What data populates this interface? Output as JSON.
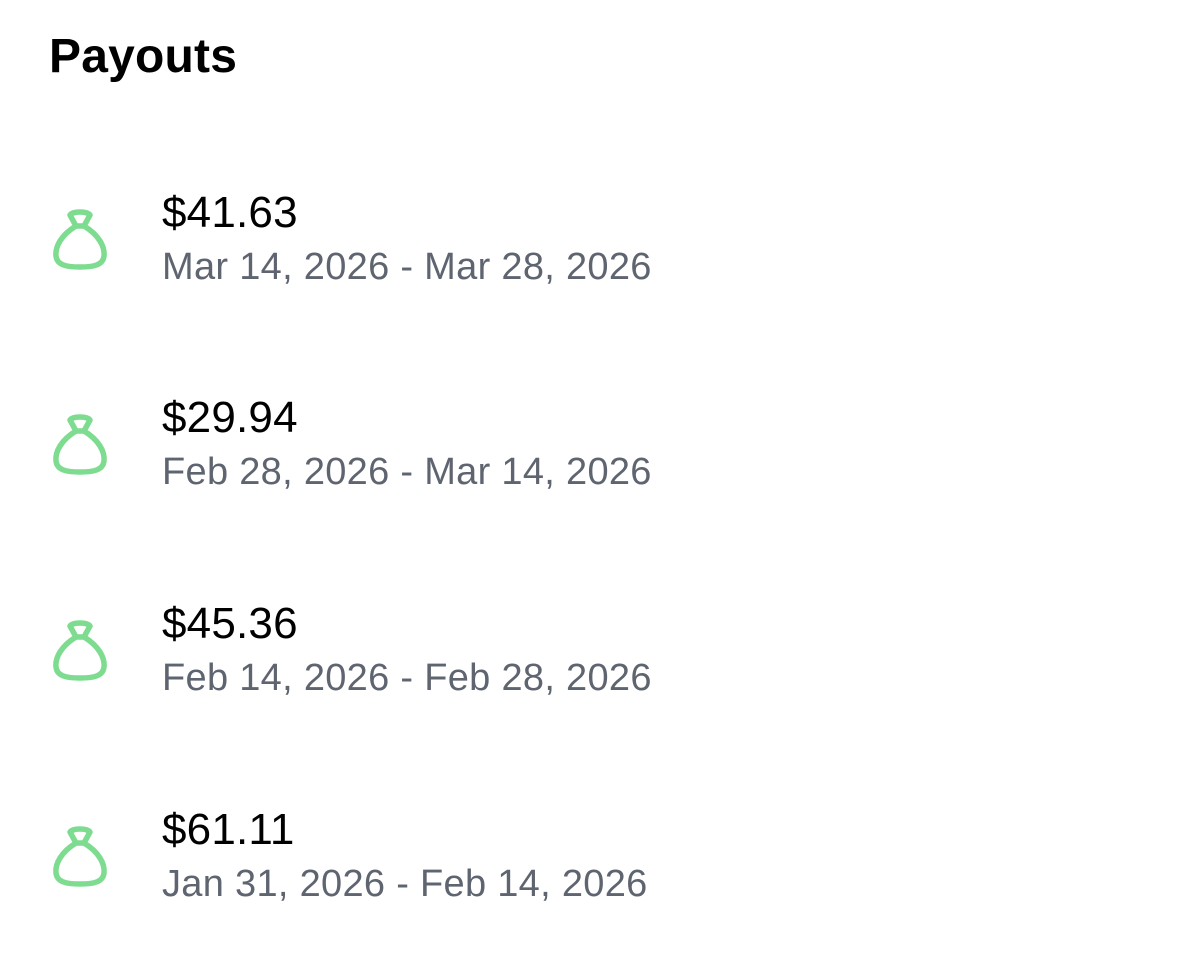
{
  "header": {
    "title": "Payouts"
  },
  "colors": {
    "icon_green": "#7ddc8f",
    "amount_text": "#000000",
    "period_text": "#5f6570"
  },
  "payouts": [
    {
      "icon": "money-bag-icon",
      "amount": "$41.63",
      "period": "Mar 14, 2026 - Mar 28, 2026"
    },
    {
      "icon": "money-bag-icon",
      "amount": "$29.94",
      "period": "Feb 28, 2026 - Mar 14, 2026"
    },
    {
      "icon": "money-bag-icon",
      "amount": "$45.36",
      "period": "Feb 14, 2026 - Feb 28, 2026"
    },
    {
      "icon": "money-bag-icon",
      "amount": "$61.11",
      "period": "Jan 31, 2026 - Feb 14, 2026"
    }
  ]
}
